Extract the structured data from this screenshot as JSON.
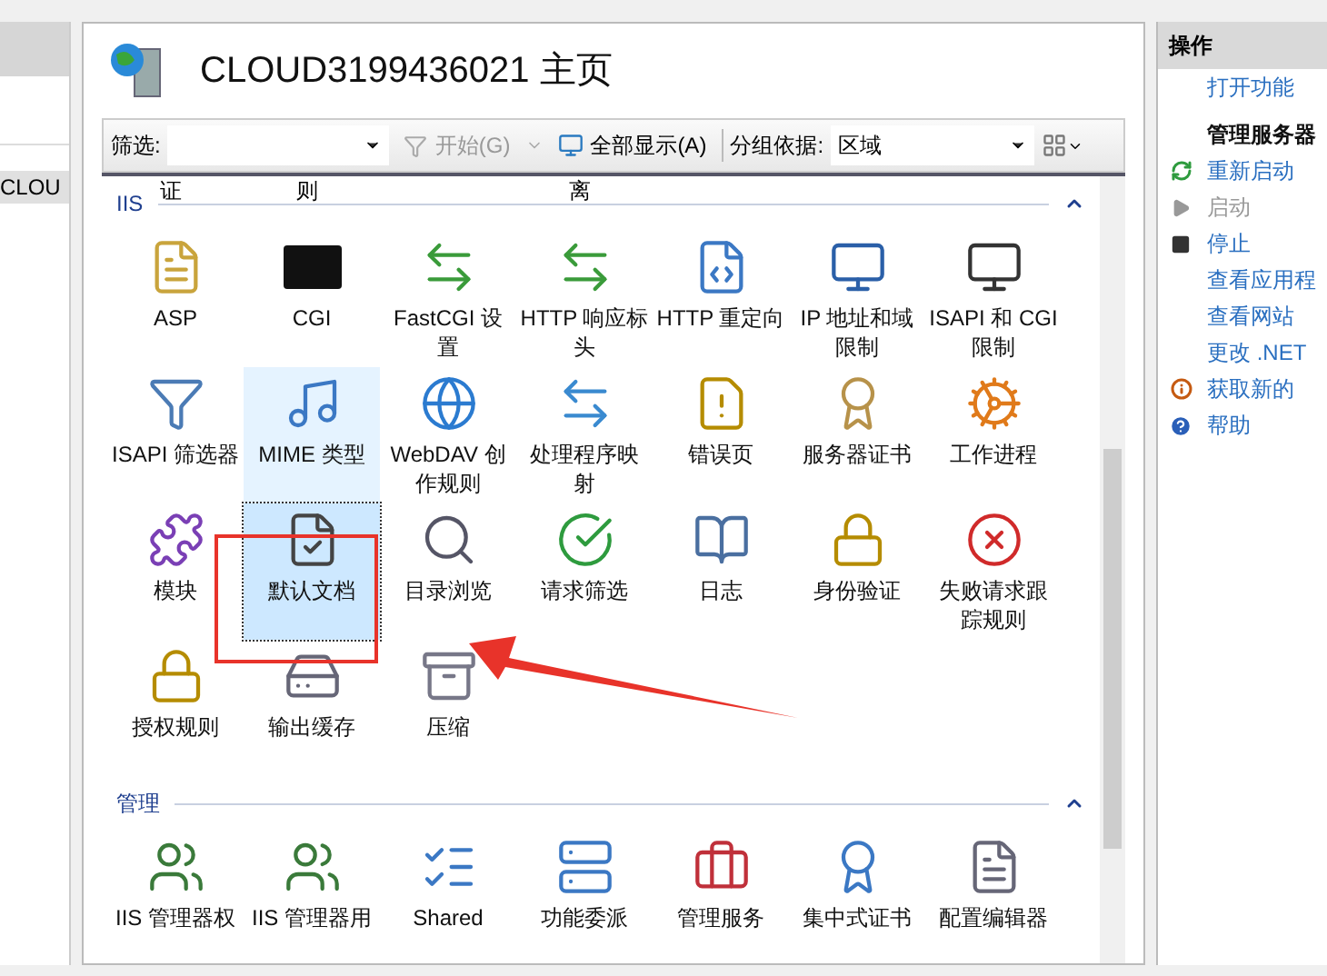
{
  "left_pane": {
    "tree_item": "CLOU"
  },
  "header": {
    "title": "CLOUD3199436021 主页"
  },
  "toolbar": {
    "filter_label": "筛选:",
    "start_button": "开始(G)",
    "show_all_button": "全部显示(A)",
    "group_label": "分组依据:",
    "group_value": "区域"
  },
  "partial_row": [
    "证",
    "则",
    "离"
  ],
  "sections": [
    {
      "title": "IIS",
      "expanded": true,
      "items": [
        {
          "label": "ASP",
          "selected": false,
          "hover": false
        },
        {
          "label": "CGI",
          "selected": false,
          "hover": false
        },
        {
          "label": "FastCGI 设置",
          "selected": false,
          "hover": false
        },
        {
          "label": "HTTP 响应标头",
          "selected": false,
          "hover": false
        },
        {
          "label": "HTTP 重定向",
          "selected": false,
          "hover": false
        },
        {
          "label": "IP 地址和域限制",
          "selected": false,
          "hover": false
        },
        {
          "label": "ISAPI 和 CGI 限制",
          "selected": false,
          "hover": false
        },
        {
          "label": "ISAPI 筛选器",
          "selected": false,
          "hover": false
        },
        {
          "label": "MIME 类型",
          "selected": false,
          "hover": true
        },
        {
          "label": "WebDAV 创作规则",
          "selected": false,
          "hover": false
        },
        {
          "label": "处理程序映射",
          "selected": false,
          "hover": false
        },
        {
          "label": "错误页",
          "selected": false,
          "hover": false
        },
        {
          "label": "服务器证书",
          "selected": false,
          "hover": false
        },
        {
          "label": "工作进程",
          "selected": false,
          "hover": false
        },
        {
          "label": "模块",
          "selected": false,
          "hover": false
        },
        {
          "label": "默认文档",
          "selected": true,
          "hover": false
        },
        {
          "label": "目录浏览",
          "selected": false,
          "hover": false
        },
        {
          "label": "请求筛选",
          "selected": false,
          "hover": false
        },
        {
          "label": "日志",
          "selected": false,
          "hover": false
        },
        {
          "label": "身份验证",
          "selected": false,
          "hover": false
        },
        {
          "label": "失败请求跟踪规则",
          "selected": false,
          "hover": false
        },
        {
          "label": "授权规则",
          "selected": false,
          "hover": false
        },
        {
          "label": "输出缓存",
          "selected": false,
          "hover": false
        },
        {
          "label": "压缩",
          "selected": false,
          "hover": false
        }
      ]
    },
    {
      "title": "管理",
      "expanded": true,
      "items": [
        {
          "label": "IIS 管理器权",
          "selected": false,
          "hover": false
        },
        {
          "label": "IIS 管理器用",
          "selected": false,
          "hover": false
        },
        {
          "label": "Shared",
          "selected": false,
          "hover": false
        },
        {
          "label": "功能委派",
          "selected": false,
          "hover": false
        },
        {
          "label": "管理服务",
          "selected": false,
          "hover": false
        },
        {
          "label": "集中式证书",
          "selected": false,
          "hover": false
        },
        {
          "label": "配置编辑器",
          "selected": false,
          "hover": false
        }
      ]
    }
  ],
  "actions": {
    "title": "操作",
    "items": [
      {
        "kind": "link",
        "label": "打开功能",
        "disabled": false
      },
      {
        "kind": "heading",
        "label": "管理服务器"
      },
      {
        "kind": "restart",
        "label": "重新启动",
        "disabled": false
      },
      {
        "kind": "start",
        "label": "启动",
        "disabled": true
      },
      {
        "kind": "stop",
        "label": "停止",
        "disabled": false
      },
      {
        "kind": "link",
        "label": "查看应用程",
        "disabled": false
      },
      {
        "kind": "link",
        "label": "查看网站",
        "disabled": false
      },
      {
        "kind": "link",
        "label": "更改 .NET",
        "disabled": false
      },
      {
        "kind": "info",
        "label": "获取新的",
        "disabled": false
      },
      {
        "kind": "help",
        "label": "帮助",
        "disabled": false
      }
    ]
  }
}
